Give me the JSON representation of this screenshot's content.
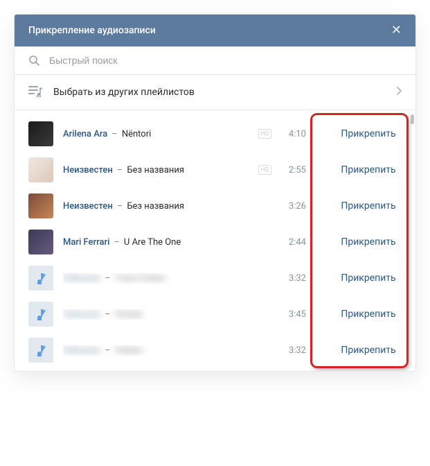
{
  "header": {
    "title": "Прикрепление аудиозаписи"
  },
  "search": {
    "placeholder": "Быстрый поиск"
  },
  "playlist_selector": {
    "label": "Выбрать из других плейлистов"
  },
  "hq_label": "HQ",
  "tracks": [
    {
      "artist": "Arilena Ara",
      "title": "Nëntori",
      "duration": "4:10",
      "hq": true,
      "cover": "img1",
      "attach": "Прикрепить"
    },
    {
      "artist": "Неизвестен",
      "title": "Без названия",
      "duration": "2:55",
      "hq": true,
      "cover": "img2",
      "attach": "Прикрепить"
    },
    {
      "artist": "Неизвестен",
      "title": "Без названия",
      "duration": "3:26",
      "hq": false,
      "cover": "img3",
      "attach": "Прикрепить"
    },
    {
      "artist": "Mari Ferrari",
      "title": "U Are The One",
      "duration": "2:44",
      "hq": false,
      "cover": "img4",
      "attach": "Прикрепить"
    },
    {
      "artist": "Unknown",
      "title": "Track hidden",
      "duration": "3:32",
      "hq": false,
      "cover": "default",
      "blurred": true,
      "attach": "Прикрепить"
    },
    {
      "artist": "Unknown",
      "title": "Hidden",
      "duration": "3:45",
      "hq": false,
      "cover": "default",
      "blurred": true,
      "attach": "Прикрепить"
    },
    {
      "artist": "Unknown",
      "title": "Hidden",
      "duration": "3:32",
      "hq": false,
      "cover": "default",
      "blurred": true,
      "attach": "Прикрепить"
    }
  ]
}
